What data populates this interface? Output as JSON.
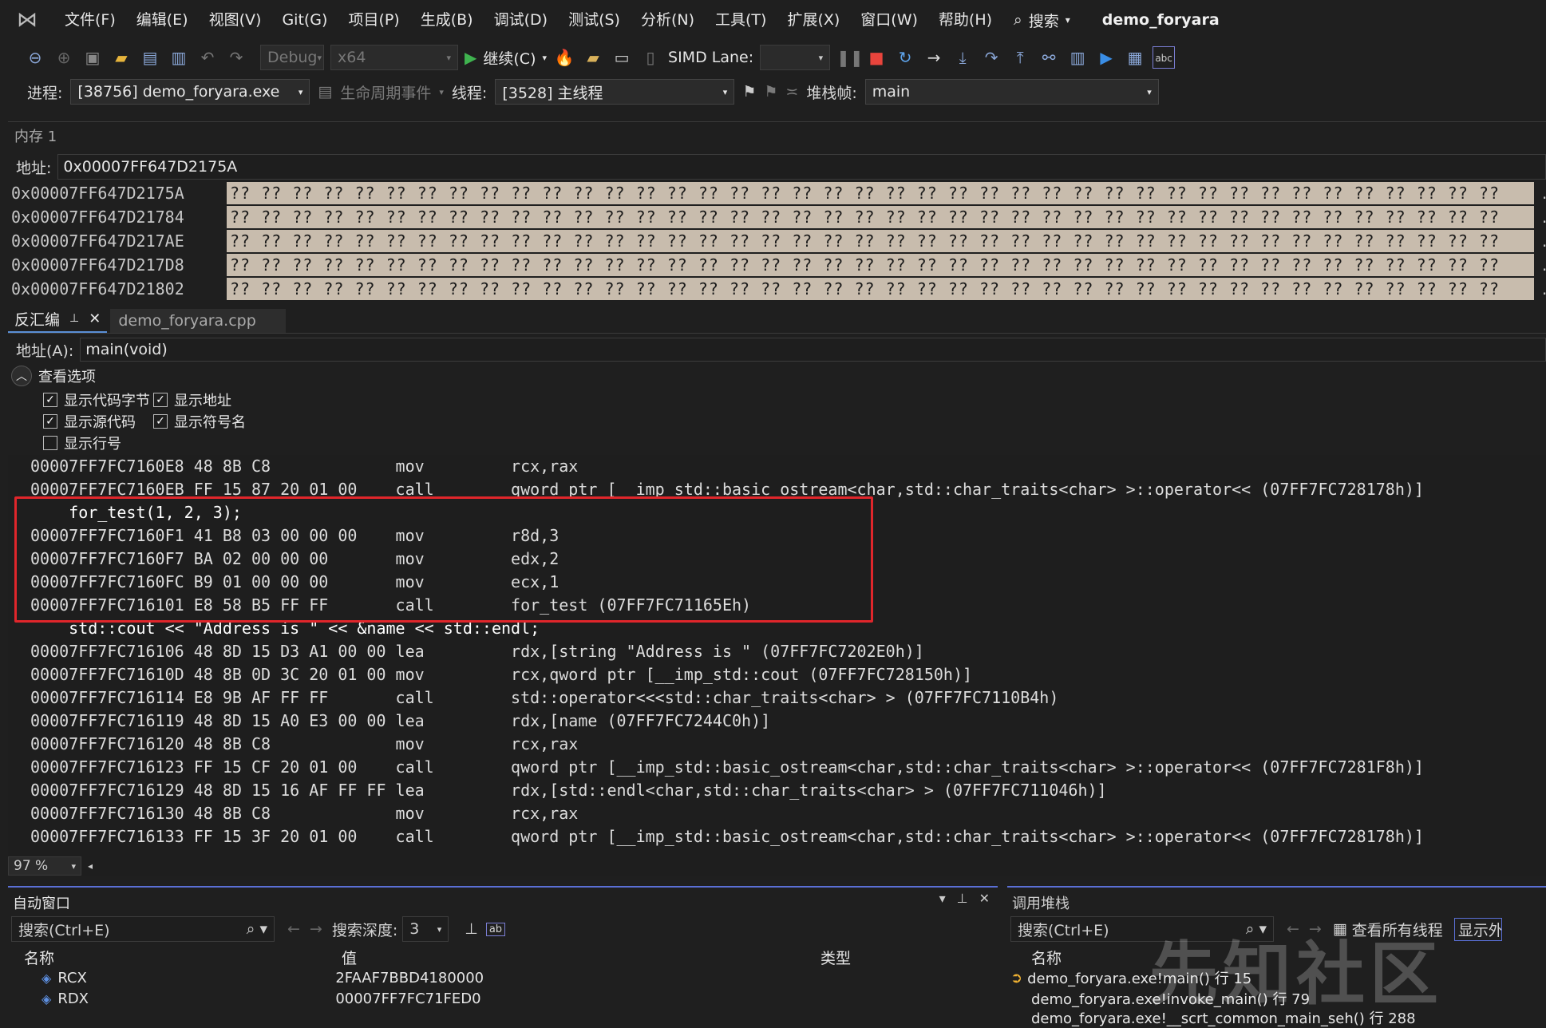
{
  "menubar": {
    "items": [
      "文件(F)",
      "编辑(E)",
      "视图(V)",
      "Git(G)",
      "项目(P)",
      "生成(B)",
      "调试(D)",
      "测试(S)",
      "分析(N)",
      "工具(T)",
      "扩展(X)",
      "窗口(W)",
      "帮助(H)"
    ],
    "search_label": "搜索",
    "window_title": "demo_foryara"
  },
  "toolbar": {
    "config": "Debug",
    "platform": "x64",
    "continue_label": "继续(C)",
    "simd_label": "SIMD Lane:"
  },
  "procbar": {
    "process_label": "进程:",
    "process_value": "[38756] demo_foryara.exe",
    "lifecycle_label": "生命周期事件",
    "thread_label": "线程:",
    "thread_value": "[3528] 主线程",
    "stackframe_label": "堆栈帧:",
    "stackframe_value": "main"
  },
  "memory": {
    "title": "内存 1",
    "address_label": "地址:",
    "address_value": "0x00007FF647D2175A",
    "rows": [
      {
        "addr": "0x00007FF647D2175A",
        "bytes": "?? ?? ?? ?? ?? ?? ?? ?? ?? ?? ?? ?? ?? ?? ?? ?? ?? ?? ?? ?? ?? ?? ?? ?? ?? ?? ?? ?? ?? ?? ?? ?? ?? ?? ?? ?? ?? ?? ?? ?? ??",
        "ascii": "."
      },
      {
        "addr": "0x00007FF647D21784",
        "bytes": "?? ?? ?? ?? ?? ?? ?? ?? ?? ?? ?? ?? ?? ?? ?? ?? ?? ?? ?? ?? ?? ?? ?? ?? ?? ?? ?? ?? ?? ?? ?? ?? ?? ?? ?? ?? ?? ?? ?? ?? ??",
        "ascii": "."
      },
      {
        "addr": "0x00007FF647D217AE",
        "bytes": "?? ?? ?? ?? ?? ?? ?? ?? ?? ?? ?? ?? ?? ?? ?? ?? ?? ?? ?? ?? ?? ?? ?? ?? ?? ?? ?? ?? ?? ?? ?? ?? ?? ?? ?? ?? ?? ?? ?? ?? ??",
        "ascii": "."
      },
      {
        "addr": "0x00007FF647D217D8",
        "bytes": "?? ?? ?? ?? ?? ?? ?? ?? ?? ?? ?? ?? ?? ?? ?? ?? ?? ?? ?? ?? ?? ?? ?? ?? ?? ?? ?? ?? ?? ?? ?? ?? ?? ?? ?? ?? ?? ?? ?? ?? ??",
        "ascii": "."
      },
      {
        "addr": "0x00007FF647D21802",
        "bytes": "?? ?? ?? ?? ?? ?? ?? ?? ?? ?? ?? ?? ?? ?? ?? ?? ?? ?? ?? ?? ?? ?? ?? ?? ?? ?? ?? ?? ?? ?? ?? ?? ?? ?? ?? ?? ?? ?? ?? ?? ??",
        "ascii": "."
      }
    ]
  },
  "disasm": {
    "tab_label": "反汇编",
    "tab2_label": "demo_foryara.cpp",
    "address_label": "地址(A):",
    "address_value": "main(void)",
    "view_options_label": "查看选项",
    "opt_code_bytes": "显示代码字节",
    "opt_address": "显示地址",
    "opt_source": "显示源代码",
    "opt_symbols": "显示符号名",
    "opt_line_numbers": "显示行号",
    "lines": [
      "00007FF7FC7160E8 48 8B C8             mov         rcx,rax",
      "00007FF7FC7160EB FF 15 87 20 01 00    call        qword ptr [__imp_std::basic_ostream<char,std::char_traits<char> >::operator<< (07FF7FC728178h)]",
      "    for_test(1, 2, 3);",
      "00007FF7FC7160F1 41 B8 03 00 00 00    mov         r8d,3",
      "00007FF7FC7160F7 BA 02 00 00 00       mov         edx,2",
      "00007FF7FC7160FC B9 01 00 00 00       mov         ecx,1",
      "00007FF7FC716101 E8 58 B5 FF FF       call        for_test (07FF7FC71165Eh)",
      "    std::cout << \"Address is \" << &name << std::endl;",
      "00007FF7FC716106 48 8D 15 D3 A1 00 00 lea         rdx,[string \"Address is \" (07FF7FC7202E0h)]",
      "00007FF7FC71610D 48 8B 0D 3C 20 01 00 mov         rcx,qword ptr [__imp_std::cout (07FF7FC728150h)]",
      "00007FF7FC716114 E8 9B AF FF FF       call        std::operator<<<std::char_traits<char> > (07FF7FC7110B4h)",
      "00007FF7FC716119 48 8D 15 A0 E3 00 00 lea         rdx,[name (07FF7FC7244C0h)]",
      "00007FF7FC716120 48 8B C8             mov         rcx,rax",
      "00007FF7FC716123 FF 15 CF 20 01 00    call        qword ptr [__imp_std::basic_ostream<char,std::char_traits<char> >::operator<< (07FF7FC7281F8h)]",
      "00007FF7FC716129 48 8D 15 16 AF FF FF lea         rdx,[std::endl<char,std::char_traits<char> > (07FF7FC711046h)]",
      "00007FF7FC716130 48 8B C8             mov         rcx,rax",
      "00007FF7FC716133 FF 15 3F 20 01 00    call        qword ptr [__imp_std::basic_ostream<char,std::char_traits<char> >::operator<< (07FF7FC728178h)]"
    ],
    "zoom": "97 %"
  },
  "autos": {
    "title": "自动窗口",
    "search_placeholder": "搜索(Ctrl+E)",
    "depth_label": "搜索深度:",
    "depth_value": "3",
    "col_name": "名称",
    "col_value": "值",
    "col_type": "类型",
    "rows": [
      {
        "name": "RCX",
        "value": "2FAAF7BBD4180000"
      },
      {
        "name": "RDX",
        "value": "00007FF7FC71FED0"
      }
    ]
  },
  "callstack": {
    "title": "调用堆栈",
    "search_placeholder": "搜索(Ctrl+E)",
    "view_threads": "查看所有线程",
    "show_label": "显示外",
    "col_name": "名称",
    "rows": [
      "demo_foryara.exe!main() 行 15",
      "demo_foryara.exe!invoke_main() 行 79",
      "demo_foryara.exe!__scrt_common_main_seh() 行 288"
    ]
  },
  "watermark": "先知社区",
  "colors": {
    "highlight_box": "#e0262b",
    "memory_bg": "#c8bcad",
    "accent": "#5a8fd6"
  }
}
